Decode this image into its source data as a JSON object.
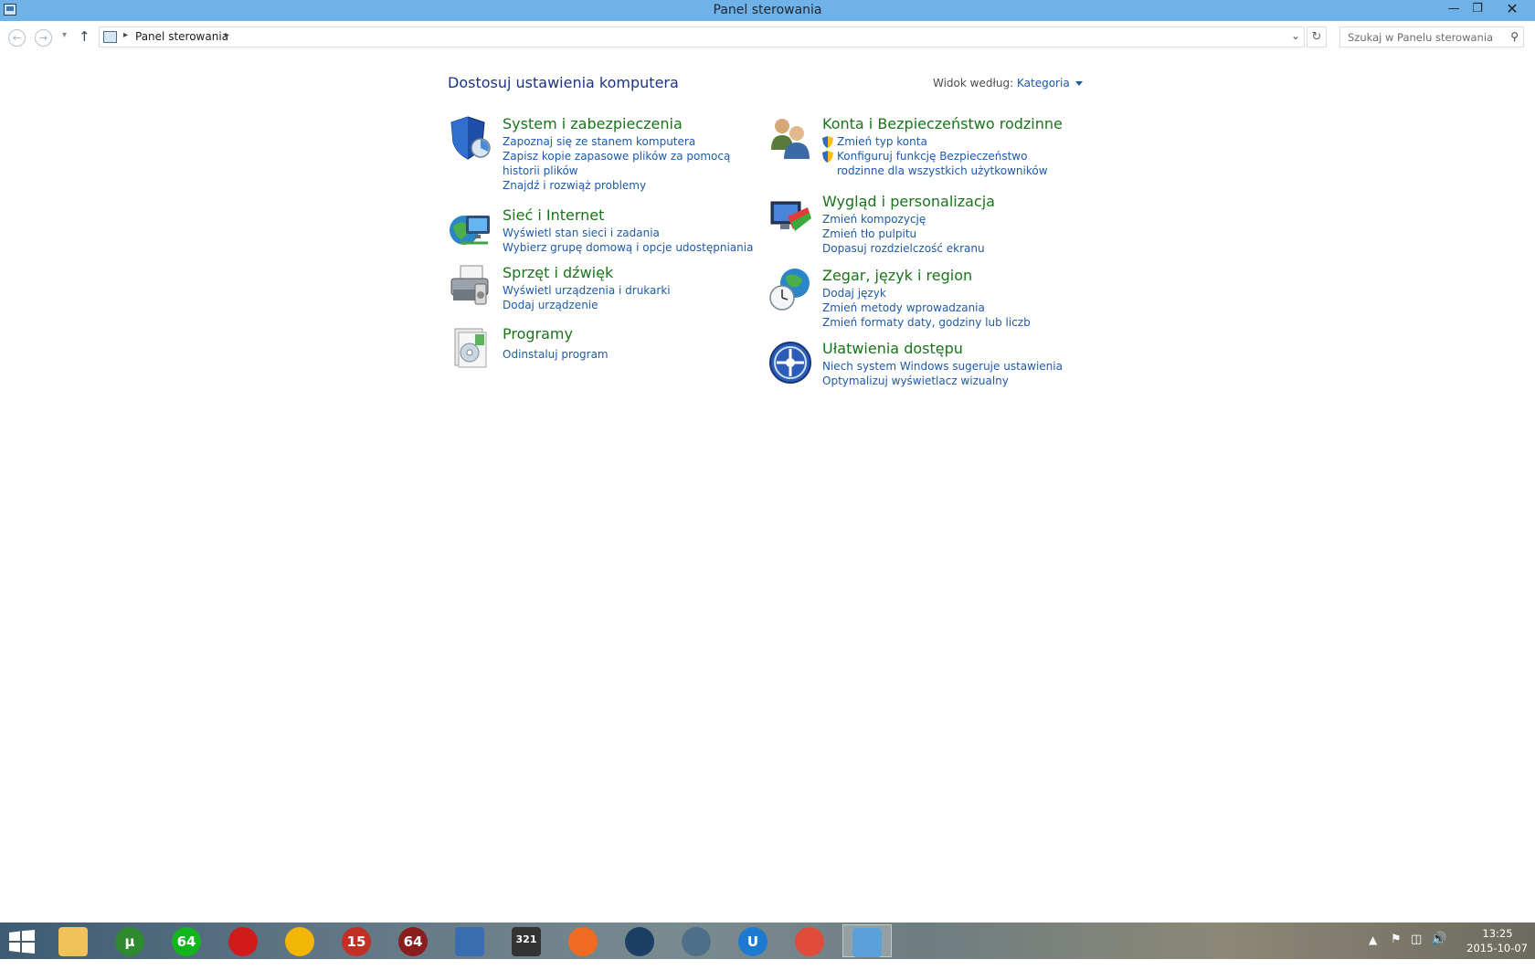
{
  "window": {
    "title": "Panel sterowania"
  },
  "address": {
    "crumb": "Panel sterowania"
  },
  "search": {
    "placeholder": "Szukaj w Panelu sterowania"
  },
  "content": {
    "heading": "Dostosuj ustawienia komputera",
    "view_by_label": "Widok według:",
    "view_by_value": "Kategoria"
  },
  "categories": [
    {
      "title": "System i zabezpieczenia",
      "links": [
        "Zapoznaj się ze stanem komputera",
        "Zapisz kopie zapasowe plików za pomocą historii plików",
        "Znajdź i rozwiąż problemy"
      ]
    },
    {
      "title": "Sieć i Internet",
      "links": [
        "Wyświetl stan sieci i zadania",
        "Wybierz grupę domową i opcje udostępniania"
      ]
    },
    {
      "title": "Sprzęt i dźwięk",
      "links": [
        "Wyświetl urządzenia i drukarki",
        "Dodaj urządzenie"
      ]
    },
    {
      "title": "Programy",
      "links": [
        "Odinstaluj program"
      ]
    },
    {
      "title": "Konta i Bezpieczeństwo rodzinne",
      "links": [
        "Zmień typ konta",
        "Konfiguruj funkcję Bezpieczeństwo rodzinne dla wszystkich użytkowników"
      ]
    },
    {
      "title": "Wygląd i personalizacja",
      "links": [
        "Zmień kompozycję",
        "Zmień tło pulpitu",
        "Dopasuj rozdzielczość ekranu"
      ]
    },
    {
      "title": "Zegar, język i region",
      "links": [
        "Dodaj język",
        "Zmień metody wprowadzania",
        "Zmień formaty daty, godziny lub liczb"
      ]
    },
    {
      "title": "Ułatwienia dostępu",
      "links": [
        "Niech system Windows sugeruje ustawienia",
        "Optymalizuj wyświetlacz wizualny"
      ]
    }
  ],
  "taskbar": {
    "apps": [
      {
        "name": "start",
        "color": "#ffffff"
      },
      {
        "name": "file-explorer",
        "color": "#f0c35a"
      },
      {
        "name": "utorrent",
        "color": "#2f8a2f",
        "label": "µ"
      },
      {
        "name": "64-app",
        "color": "#12b51c",
        "label": "64"
      },
      {
        "name": "record",
        "color": "#d11b1b"
      },
      {
        "name": "warning-app",
        "color": "#f2b705"
      },
      {
        "name": "age-rating-app",
        "color": "#c22f24",
        "label": "15"
      },
      {
        "name": "gear-64-app",
        "color": "#8a1d1d",
        "label": "64"
      },
      {
        "name": "mail-app",
        "color": "#3a6db0"
      },
      {
        "name": "clapper-app",
        "color": "#333333",
        "label": "321"
      },
      {
        "name": "origin",
        "color": "#f06a22"
      },
      {
        "name": "steam",
        "color": "#1c3f66"
      },
      {
        "name": "tool-app",
        "color": "#4f6f88"
      },
      {
        "name": "uplay",
        "color": "#1c7bd1",
        "label": "U"
      },
      {
        "name": "chrome",
        "color": "#e04b3b"
      },
      {
        "name": "control-panel",
        "color": "#5aa0da"
      }
    ],
    "time": "13:25",
    "date": "2015-10-07"
  }
}
